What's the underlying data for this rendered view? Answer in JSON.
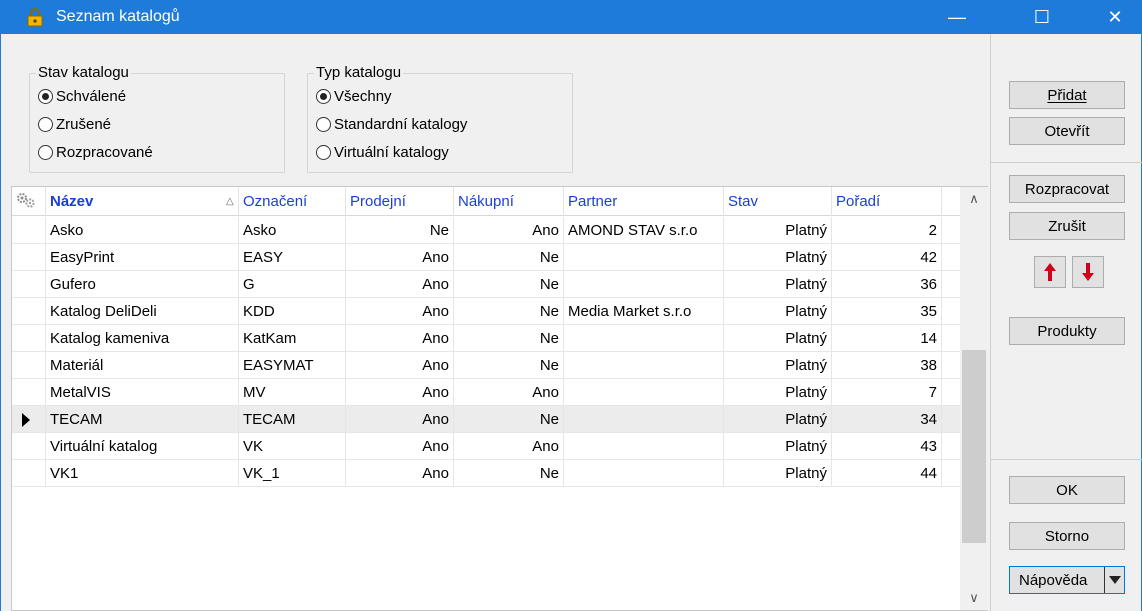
{
  "window": {
    "title": "Seznam katalogů",
    "minimize": "—",
    "maximize": "☐",
    "close": "✕"
  },
  "stav_katalogu": {
    "legend": "Stav katalogu",
    "options": [
      "Schválené",
      "Zrušené",
      "Rozpracované"
    ],
    "selected": "Schválené"
  },
  "typ_katalogu": {
    "legend": "Typ katalogu",
    "options": [
      "Všechny",
      "Standardní katalogy",
      "Virtuální katalogy"
    ],
    "selected": "Všechny"
  },
  "table": {
    "columns": [
      "Název",
      "Označení",
      "Prodejní",
      "Nákupní",
      "Partner",
      "Stav",
      "Pořadí"
    ],
    "sorted_by": "Název",
    "current_row": 7,
    "rows": [
      [
        "Asko",
        "Asko",
        "Ne",
        "Ano",
        "AMOND STAV s.r.o",
        "Platný",
        "2"
      ],
      [
        "EasyPrint",
        "EASY",
        "Ano",
        "Ne",
        "",
        "Platný",
        "42"
      ],
      [
        "Gufero",
        "G",
        "Ano",
        "Ne",
        "",
        "Platný",
        "36"
      ],
      [
        "Katalog DeliDeli",
        "KDD",
        "Ano",
        "Ne",
        "Media Market s.r.o",
        "Platný",
        "35"
      ],
      [
        "Katalog kameniva",
        "KatKam",
        "Ano",
        "Ne",
        "",
        "Platný",
        "14"
      ],
      [
        "Materiál",
        "EASYMAT",
        "Ano",
        "Ne",
        "",
        "Platný",
        "38"
      ],
      [
        "MetalVIS",
        "MV",
        "Ano",
        "Ano",
        "",
        "Platný",
        "7"
      ],
      [
        "TECAM",
        "TECAM",
        "Ano",
        "Ne",
        "",
        "Platný",
        "34"
      ],
      [
        "Virtuální katalog",
        "VK",
        "Ano",
        "Ano",
        "",
        "Platný",
        "43"
      ],
      [
        "VK1",
        "VK_1",
        "Ano",
        "Ne",
        "",
        "Platný",
        "44"
      ]
    ]
  },
  "side": {
    "pridat": "Přidat",
    "otevrit": "Otevřít",
    "rozpracovat": "Rozpracovat",
    "zrusit": "Zrušit",
    "produkty": "Produkty",
    "ok": "OK",
    "storno": "Storno",
    "napoveda": "Nápověda"
  },
  "colors": {
    "titlebar": "#1e7bd9",
    "header_text": "#1a3fd6",
    "arrow_red": "#d0021b"
  }
}
